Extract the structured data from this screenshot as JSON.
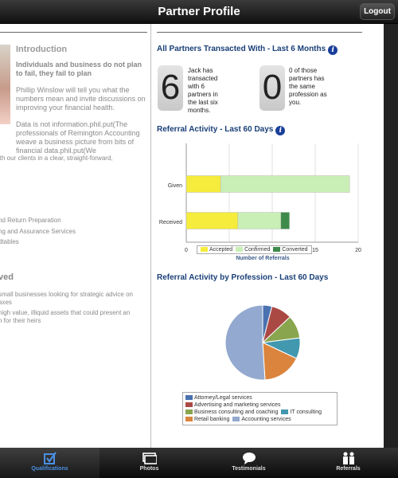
{
  "navbar": {
    "title": "Partner Profile",
    "logout_label": "Logout"
  },
  "left": {
    "intro_title": "Introduction",
    "intro_bold": "Individuals and business do not plan to fail, they fail to plan",
    "p1": "Phillip Winslow will tell you what the numbers mean and invite discussions on improving your financial health.",
    "p2": "Data is not information.phil.put(The professionals of Remington Accounting weave a business picture from bits of financial data.phil.put(We",
    "p2_cut": "ith our clients in a clear, straight-forward,",
    "services": [
      "nd Return Preparation",
      "ng and Assurance Services",
      "dtables"
    ],
    "ved_title": "ved",
    "ved_lines": [
      "small businesses looking for strategic advice on",
      "axes",
      "high value, illiquid assets that could present an",
      "n for their heirs"
    ]
  },
  "partners": {
    "title": "All Partners Transacted With - Last 6 Months",
    "count1": "6",
    "text1": "Jack has transacted with 6 partners in the last six months.",
    "count2": "0",
    "text2": "0 of those partners has the same profession as you."
  },
  "referral": {
    "title": "Referral Activity - Last 60 Days",
    "xlabel": "Number of Referrals",
    "ticks": [
      "0",
      "5",
      "10",
      "15",
      "20"
    ],
    "legend": [
      "Accepted",
      "Confirmed",
      "Converted"
    ]
  },
  "profession": {
    "title": "Referral Activity by Profession - Last 60 Days"
  },
  "colors": {
    "accepted": "#f5ec3b",
    "confirmed": "#c9efb6",
    "converted": "#3e8a4a",
    "title_blue": "#1a3f77"
  },
  "chart_data": [
    {
      "type": "bar",
      "orientation": "horizontal",
      "stacked": true,
      "categories": [
        "Given",
        "Received"
      ],
      "series": [
        {
          "name": "Accepted",
          "values": [
            4,
            6
          ]
        },
        {
          "name": "Confirmed",
          "values": [
            15,
            5
          ]
        },
        {
          "name": "Converted",
          "values": [
            0,
            1
          ]
        }
      ],
      "xlabel": "Number of Referrals",
      "xlim": [
        0,
        20
      ],
      "grid": true,
      "legend": "bottom"
    },
    {
      "type": "pie",
      "categories": [
        "Attorney/Legal services",
        "Advertising and marketing services",
        "Business consulting and coaching",
        "IT consulting",
        "Retail banking",
        "Accounting services"
      ],
      "values": [
        4,
        9,
        10,
        9,
        17,
        51
      ],
      "colors": [
        "#4a72b0",
        "#aa4944",
        "#89a54e",
        "#4298af",
        "#db843d",
        "#93a9cf"
      ],
      "legend": "bottom"
    }
  ],
  "tabs": [
    {
      "label": "Qualifications",
      "icon": "checkbox-icon"
    },
    {
      "label": "Photos",
      "icon": "photos-icon"
    },
    {
      "label": "Testimonials",
      "icon": "speech-bubble-icon"
    },
    {
      "label": "Referrals",
      "icon": "people-icon"
    }
  ]
}
